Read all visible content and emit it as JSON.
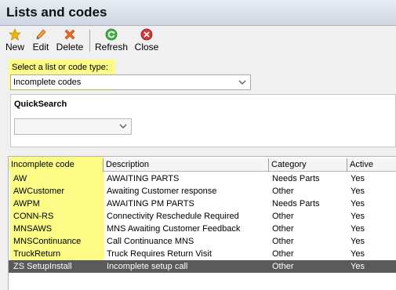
{
  "window": {
    "title": "Lists and codes"
  },
  "toolbar": {
    "new": "New",
    "edit": "Edit",
    "delete": "Delete",
    "refresh": "Refresh",
    "close": "Close"
  },
  "list_type": {
    "label": "Select a list or code type:",
    "value": "Incomplete codes"
  },
  "quick_search": {
    "label": "QuickSearch",
    "value": ""
  },
  "grid": {
    "columns": [
      "Incomplete code",
      "Description",
      "Category",
      "Active"
    ],
    "rows": [
      {
        "code": "AW",
        "description": "AWAITING PARTS",
        "category": "Needs Parts",
        "active": "Yes"
      },
      {
        "code": "AWCustomer",
        "description": "Awaiting Customer response",
        "category": "Other",
        "active": "Yes"
      },
      {
        "code": "AWPM",
        "description": "AWAITING PM PARTS",
        "category": "Needs Parts",
        "active": "Yes"
      },
      {
        "code": "CONN-RS",
        "description": "Connectivity Reschedule Required",
        "category": "Other",
        "active": "Yes"
      },
      {
        "code": "MNSAWS",
        "description": "MNS Awaiting Customer Feedback",
        "category": "Other",
        "active": "Yes"
      },
      {
        "code": "MNSContinuance",
        "description": "Call Continuance MNS",
        "category": "Other",
        "active": "Yes"
      },
      {
        "code": "TruckReturn",
        "description": "Truck Requires Return Visit",
        "category": "Other",
        "active": "Yes"
      },
      {
        "code": "ZS SetupInstall",
        "description": "Incomplete setup call",
        "category": "Other",
        "active": "Yes"
      }
    ],
    "selected_row": 7
  },
  "colors": {
    "highlight": "#fcfb86",
    "selected_row": "#5a5a5a",
    "new_icon": "#f5b400",
    "edit_icon": "#e07a1f",
    "delete_icon": "#e05a1a",
    "refresh_icon": "#3aa53a",
    "close_icon": "#cc2a2a"
  },
  "icons": {
    "new": "star-icon",
    "edit": "pencil-icon",
    "delete": "x-icon",
    "refresh": "refresh-icon",
    "close": "close-circle-icon"
  }
}
